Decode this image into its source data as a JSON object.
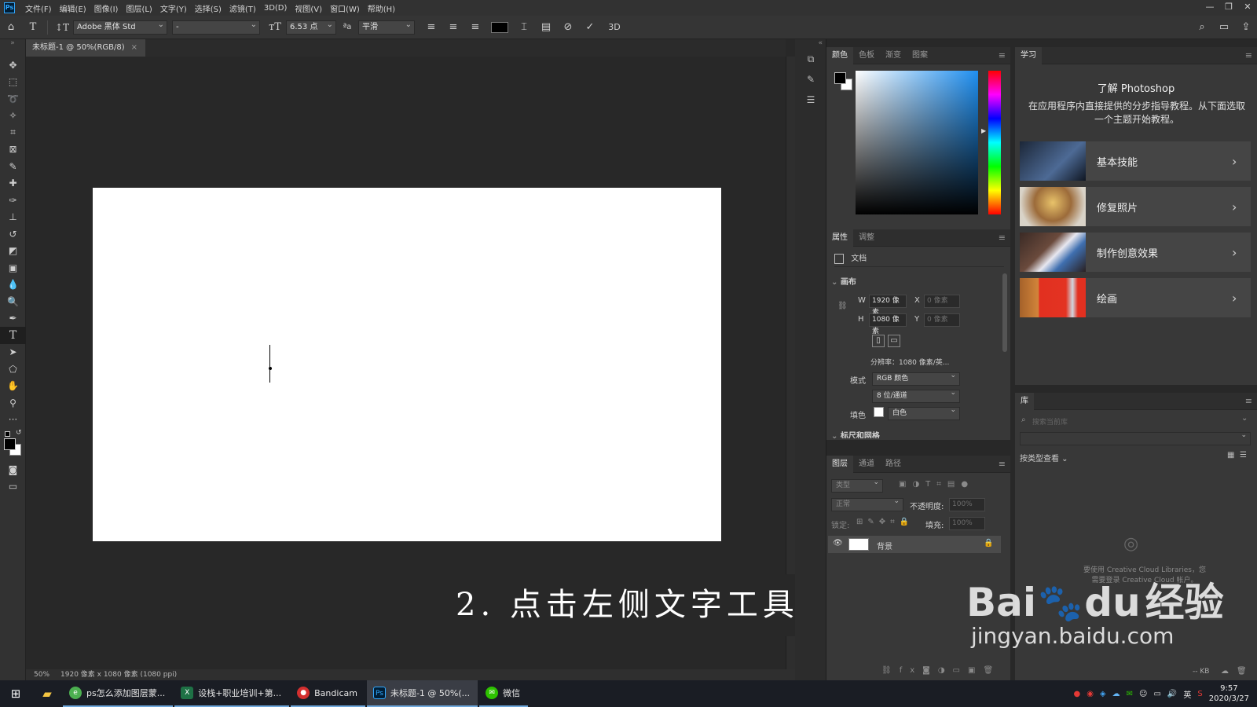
{
  "menu": {
    "logo": "Ps",
    "items": [
      "文件(F)",
      "编辑(E)",
      "图像(I)",
      "图层(L)",
      "文字(Y)",
      "选择(S)",
      "滤镜(T)",
      "3D(D)",
      "视图(V)",
      "窗口(W)",
      "帮助(H)"
    ]
  },
  "window_controls": [
    "—",
    "❐",
    "✕"
  ],
  "options": {
    "font_family": "Adobe 黑体 Std",
    "font_style": "-",
    "font_size": "6.53 点",
    "antialias": "平滑",
    "three_d": "3D",
    "text_color": "#000000"
  },
  "document": {
    "tab_title": "未标题-1 @ 50%(RGB/8)",
    "tab_close": "×",
    "status_zoom": "50%",
    "status_info": "1920 像素 x 1080 像素 (1080 ppi)"
  },
  "caption": "2. 点击左侧文字工具",
  "color_panel": {
    "tabs": [
      "颜色",
      "色板",
      "渐变",
      "图案"
    ]
  },
  "properties": {
    "tabs": [
      "属性",
      "调整"
    ],
    "doc_label": "文档",
    "section": "画布",
    "w_label": "W",
    "w_value": "1920 像素",
    "h_label": "H",
    "h_value": "1080 像素",
    "x_label": "X",
    "x_value": "0 像素",
    "y_label": "Y",
    "y_value": "0 像素",
    "resolution": "分辨率：1080 像素/英...",
    "mode_label": "模式",
    "mode_value": "RGB 颜色",
    "depth_value": "8 位/通道",
    "fill_label": "填色",
    "fill_value": "白色",
    "next_section": "标尺和网格"
  },
  "layers": {
    "tabs": [
      "图层",
      "通道",
      "路径"
    ],
    "filter_placeholder": "类型",
    "blend_mode": "正常",
    "opacity_label": "不透明度:",
    "opacity_value": "100%",
    "lock_label": "锁定:",
    "fill_label": "填充:",
    "fill_value": "100%",
    "layer_name": "背景"
  },
  "learn": {
    "tab": "学习",
    "title": "了解 Photoshop",
    "desc": "在应用程序内直接提供的分步指导教程。从下面选取一个主题开始教程。",
    "cards": [
      "基本技能",
      "修复照片",
      "制作创意效果",
      "绘画"
    ]
  },
  "library": {
    "tab": "库",
    "search_placeholder": "搜索当前库",
    "view_by": "按类型查看",
    "cc_text_1": "要使用 Creative Cloud Libraries，您",
    "cc_text_2": "需要登录 Creative Cloud 帐户。",
    "kb": "-- KB"
  },
  "watermark": {
    "brand": "Bai",
    "brand2": "经验",
    "url": "jingyan.baidu.com"
  },
  "taskbar": {
    "items": [
      {
        "label": "ps怎么添加图层蒙...",
        "color": "#4caf50",
        "glyph": "e"
      },
      {
        "label": "设栈+职业培训+第...",
        "color": "#1e7145",
        "glyph": "X"
      },
      {
        "label": "Bandicam",
        "color": "#d32f2f",
        "glyph": "●"
      },
      {
        "label": "未标题-1 @ 50%(...",
        "color": "#001e36",
        "glyph": "Ps"
      },
      {
        "label": "微信",
        "color": "#2dc100",
        "glyph": "✉"
      }
    ],
    "lang": "英",
    "time": "9:57",
    "date": "2020/3/27"
  }
}
